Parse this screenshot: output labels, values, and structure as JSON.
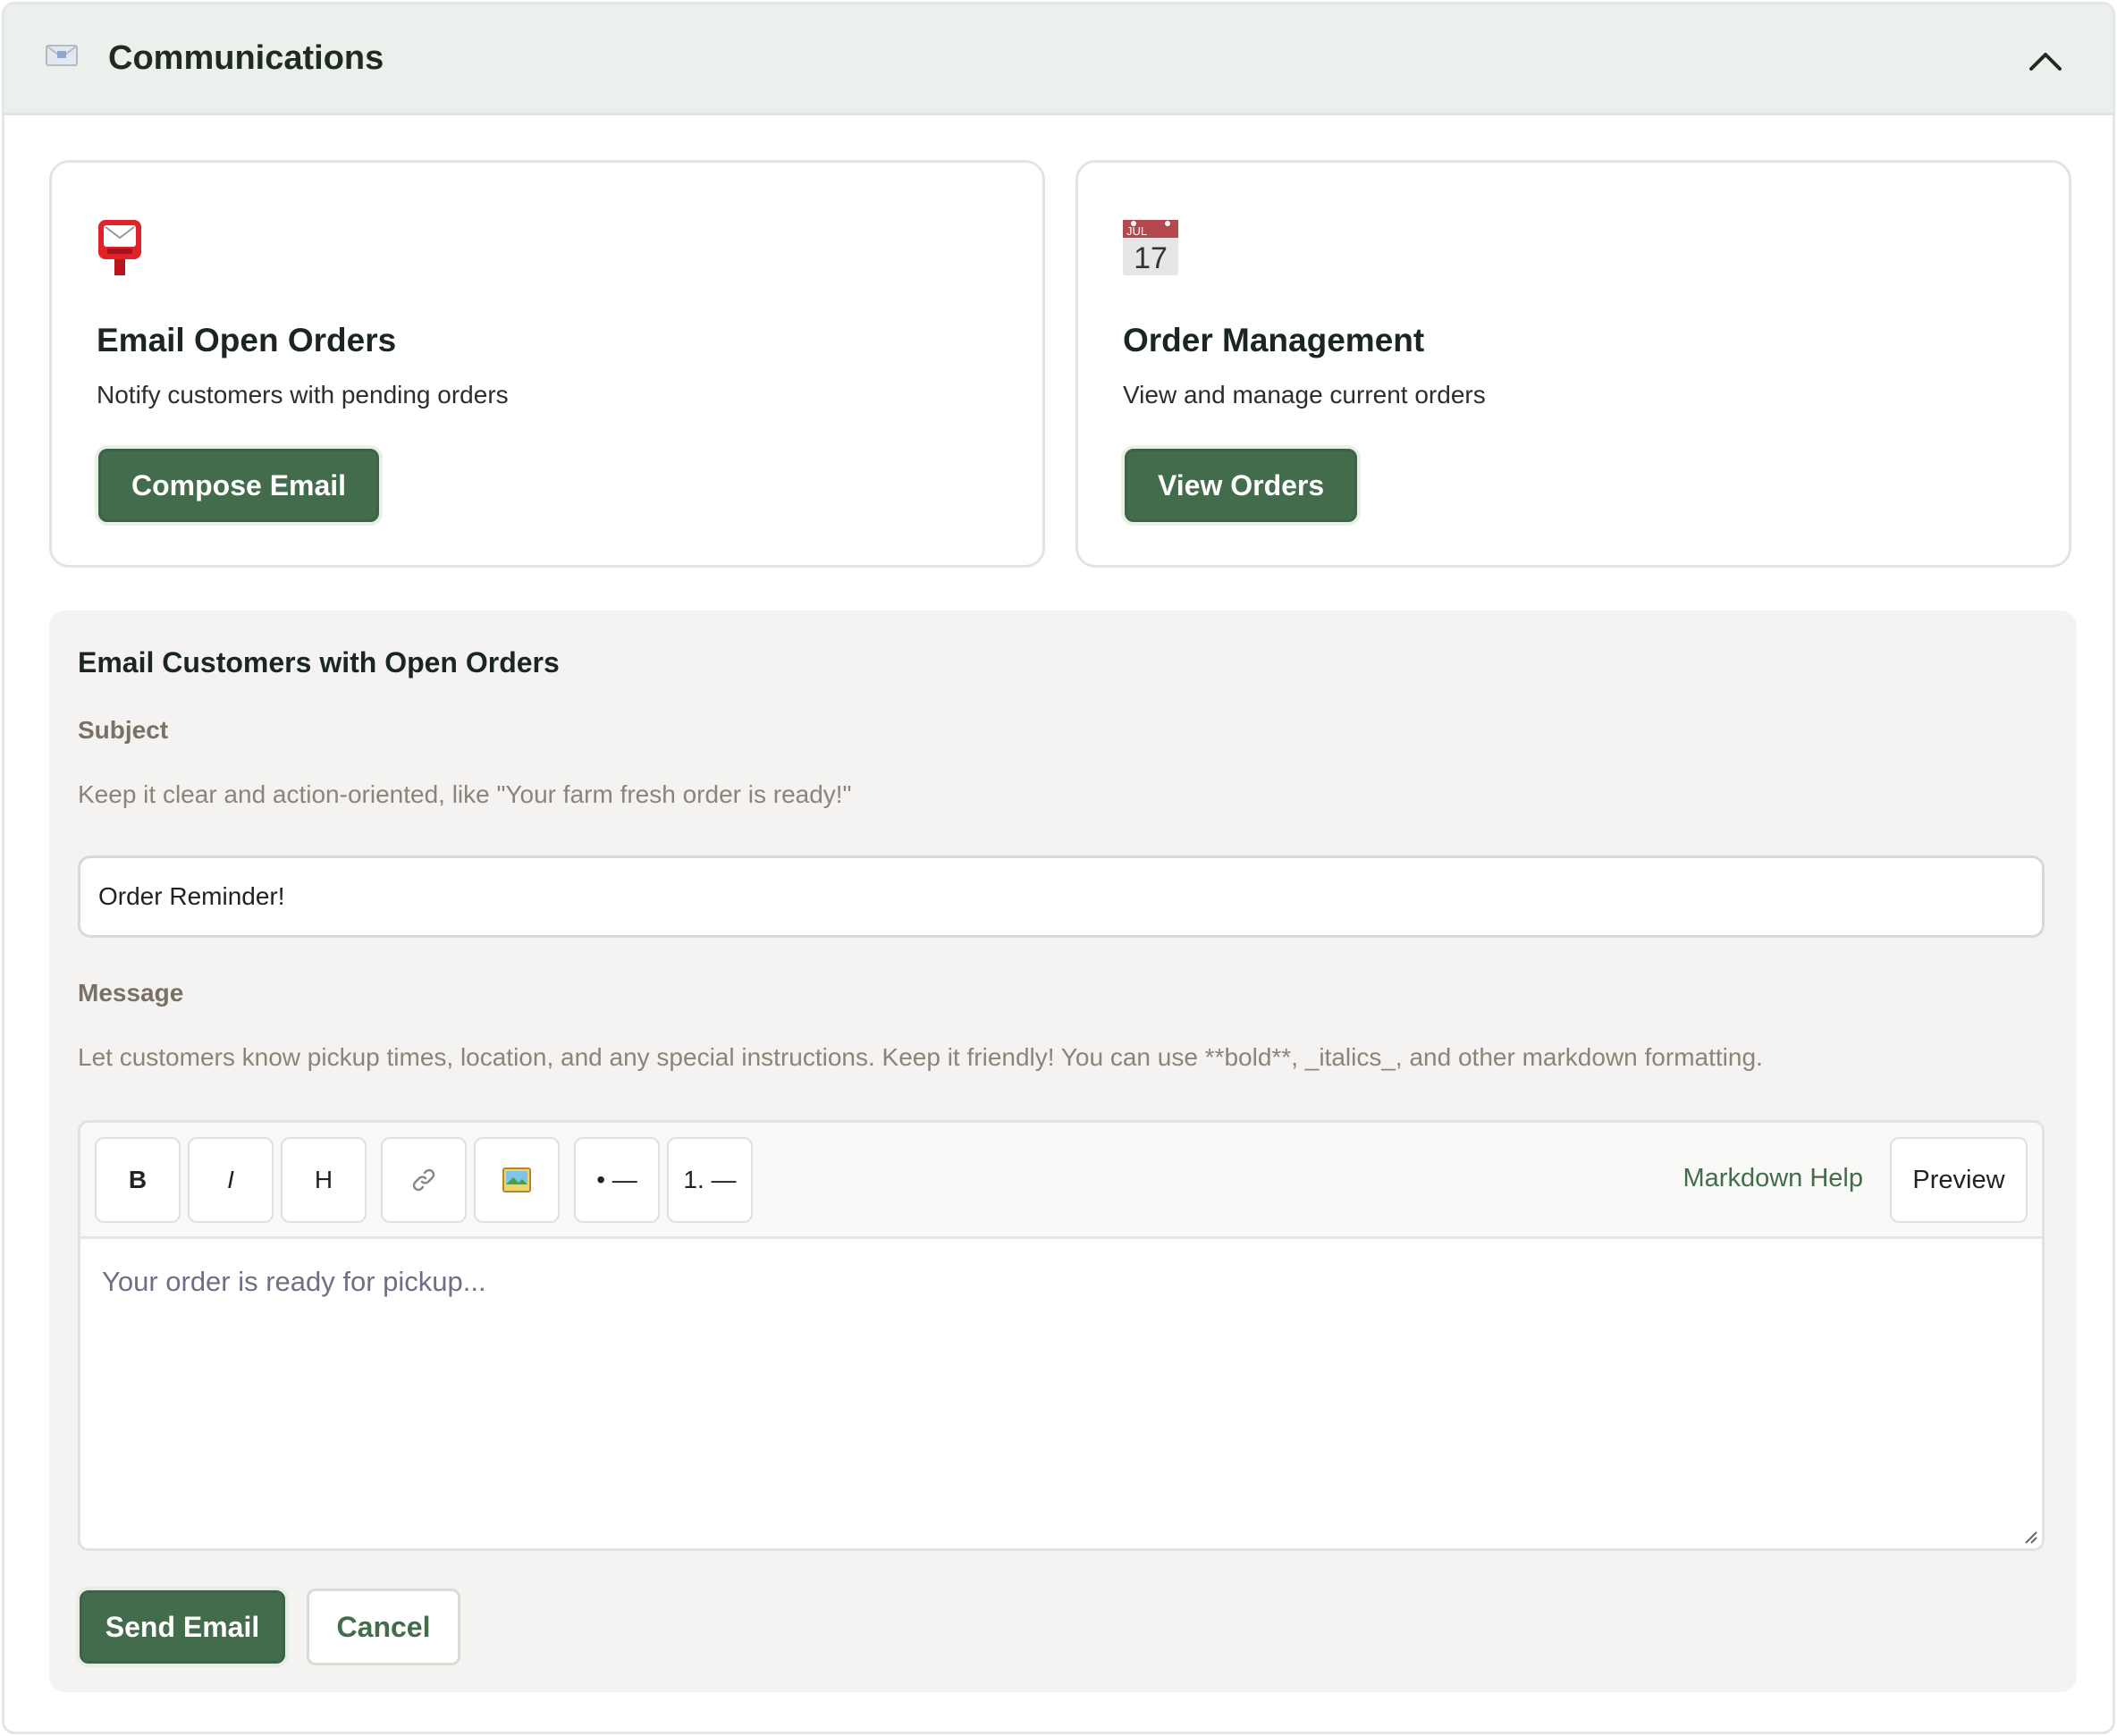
{
  "header": {
    "icon": "envelope-icon",
    "title": "Communications",
    "collapse_icon": "chevron-up-icon"
  },
  "cards": [
    {
      "icon": "postbox-icon",
      "title": "Email Open Orders",
      "description": "Notify customers with pending orders",
      "button_label": "Compose Email"
    },
    {
      "icon": "calendar-icon",
      "calendar_month": "JUL",
      "calendar_day": "17",
      "title": "Order Management",
      "description": "View and manage current orders",
      "button_label": "View Orders"
    }
  ],
  "form": {
    "title": "Email Customers with Open Orders",
    "subject_label": "Subject",
    "subject_hint": "Keep it clear and action-oriented, like \"Your farm fresh order is ready!\"",
    "subject_value": "Order Reminder!",
    "message_label": "Message",
    "message_hint": "Let customers know pickup times, location, and any special instructions. Keep it friendly! You can use **bold**, _italics_, and other markdown formatting.",
    "message_placeholder": "Your order is ready for pickup...",
    "toolbar": {
      "bold": "B",
      "italic": "I",
      "heading": "H",
      "link_icon": "link-icon",
      "image_icon": "image-icon",
      "bullet_list": "• —",
      "numbered_list": "1. —",
      "markdown_help": "Markdown Help",
      "preview": "Preview"
    },
    "send_label": "Send Email",
    "cancel_label": "Cancel"
  },
  "colors": {
    "accent": "#426c4c",
    "header_bg": "#ecf0ed",
    "form_bg": "#f4f3f1",
    "hint_text": "#8d8478"
  }
}
